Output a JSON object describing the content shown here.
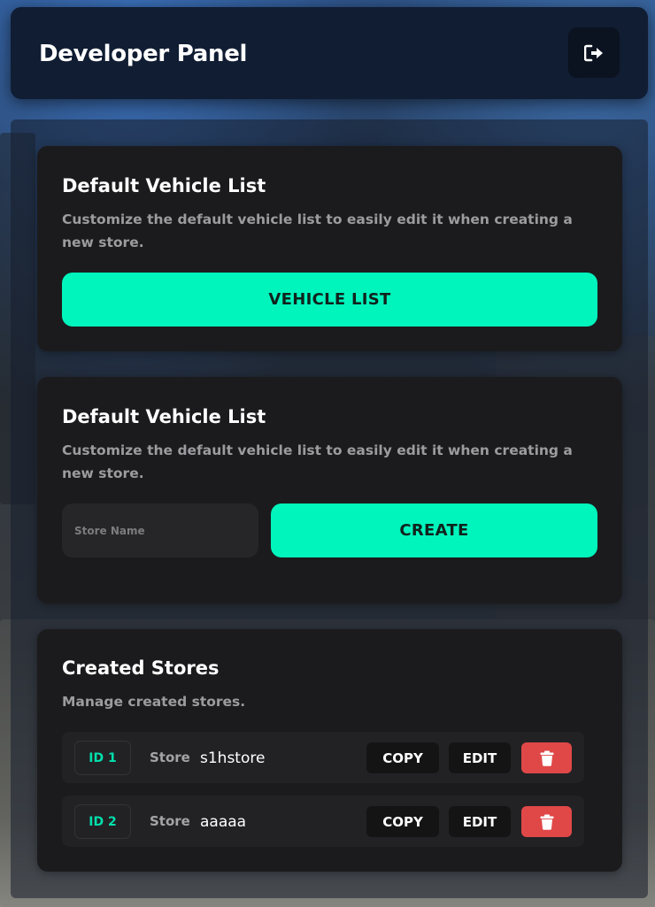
{
  "header": {
    "title": "Developer Panel"
  },
  "vehicle_list_card": {
    "title": "Default Vehicle List",
    "description": "Customize the default vehicle list to easily edit it when creating a new store.",
    "button_label": "VEHICLE LIST"
  },
  "create_store_card": {
    "title": "Default Vehicle List",
    "description": "Customize the default vehicle list to easily edit it when creating a new store.",
    "input_value": "",
    "input_placeholder": "Store Name",
    "button_label": "CREATE"
  },
  "created_stores": {
    "title": "Created Stores",
    "description": "Manage created stores.",
    "store_label": "Store",
    "copy_label": "COPY",
    "edit_label": "EDIT",
    "rows": [
      {
        "id": "ID 1",
        "name": "s1hstore"
      },
      {
        "id": "ID 2",
        "name": "aaaaa"
      }
    ]
  },
  "colors": {
    "accent": "#00f5bd",
    "danger": "#e04848",
    "card_bg": "#1b1b1d",
    "header_bg": "#101d33"
  },
  "icons": {
    "exit": "sign-out-icon",
    "delete": "trash-icon"
  }
}
